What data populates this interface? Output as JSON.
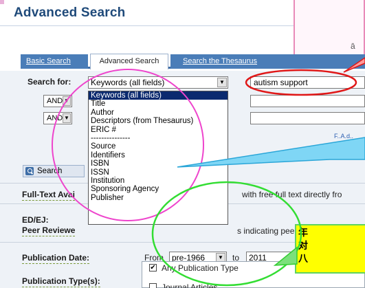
{
  "page": {
    "title": "Advanced Search"
  },
  "tabs": [
    {
      "label": "Basic Search"
    },
    {
      "label": "Advanced Search"
    },
    {
      "label": "Search the Thesaurus"
    }
  ],
  "search": {
    "label": "Search for:",
    "field_value": "Keywords (all fields)",
    "query_value": "autism  support",
    "bool1": "AND",
    "bool2": "AND",
    "field_options": [
      "Keywords (all fields)",
      "Title",
      "Author",
      "Descriptors (from Thesaurus)",
      "ERIC #",
      "---------------",
      "Source",
      "Identifiers",
      "ISBN",
      "ISSN",
      "Institution",
      "Sponsoring Agency",
      "Publisher"
    ],
    "button_label": "Search"
  },
  "filters": {
    "fulltext_label": "Full-Text Avai",
    "fulltext_text": "with free full text directly fro",
    "ed_ej_label": "ED/EJ:",
    "peer_label": "Peer Reviewe",
    "peer_text": "s indicating peer review",
    "pubdate_label": "Publication Date:",
    "pubdate_from_label": "From",
    "pubdate_from": "pre-1966",
    "pubdate_to_label": "to",
    "pubdate_to": "2011",
    "pubtype_label": "Publication Type(s):",
    "pubtype_any": "Any Publication Type",
    "pubtype_journal": "Journal Articles",
    "partial_link": "F..A.d.."
  },
  "annotations": {
    "top_note_fragment": "ā",
    "callout_lines": [
      "年",
      "对",
      "八"
    ]
  },
  "colors": {
    "title": "#1f4a7a",
    "tab_blue": "#4a7db8",
    "dropdown_selected": "#0b2a6f",
    "circle_red": "#e01818",
    "circle_magenta": "#ee44cc",
    "circle_green": "#33dd33",
    "callout_yellow": "#ffff00",
    "callout_cyan": "#55c8f0"
  }
}
